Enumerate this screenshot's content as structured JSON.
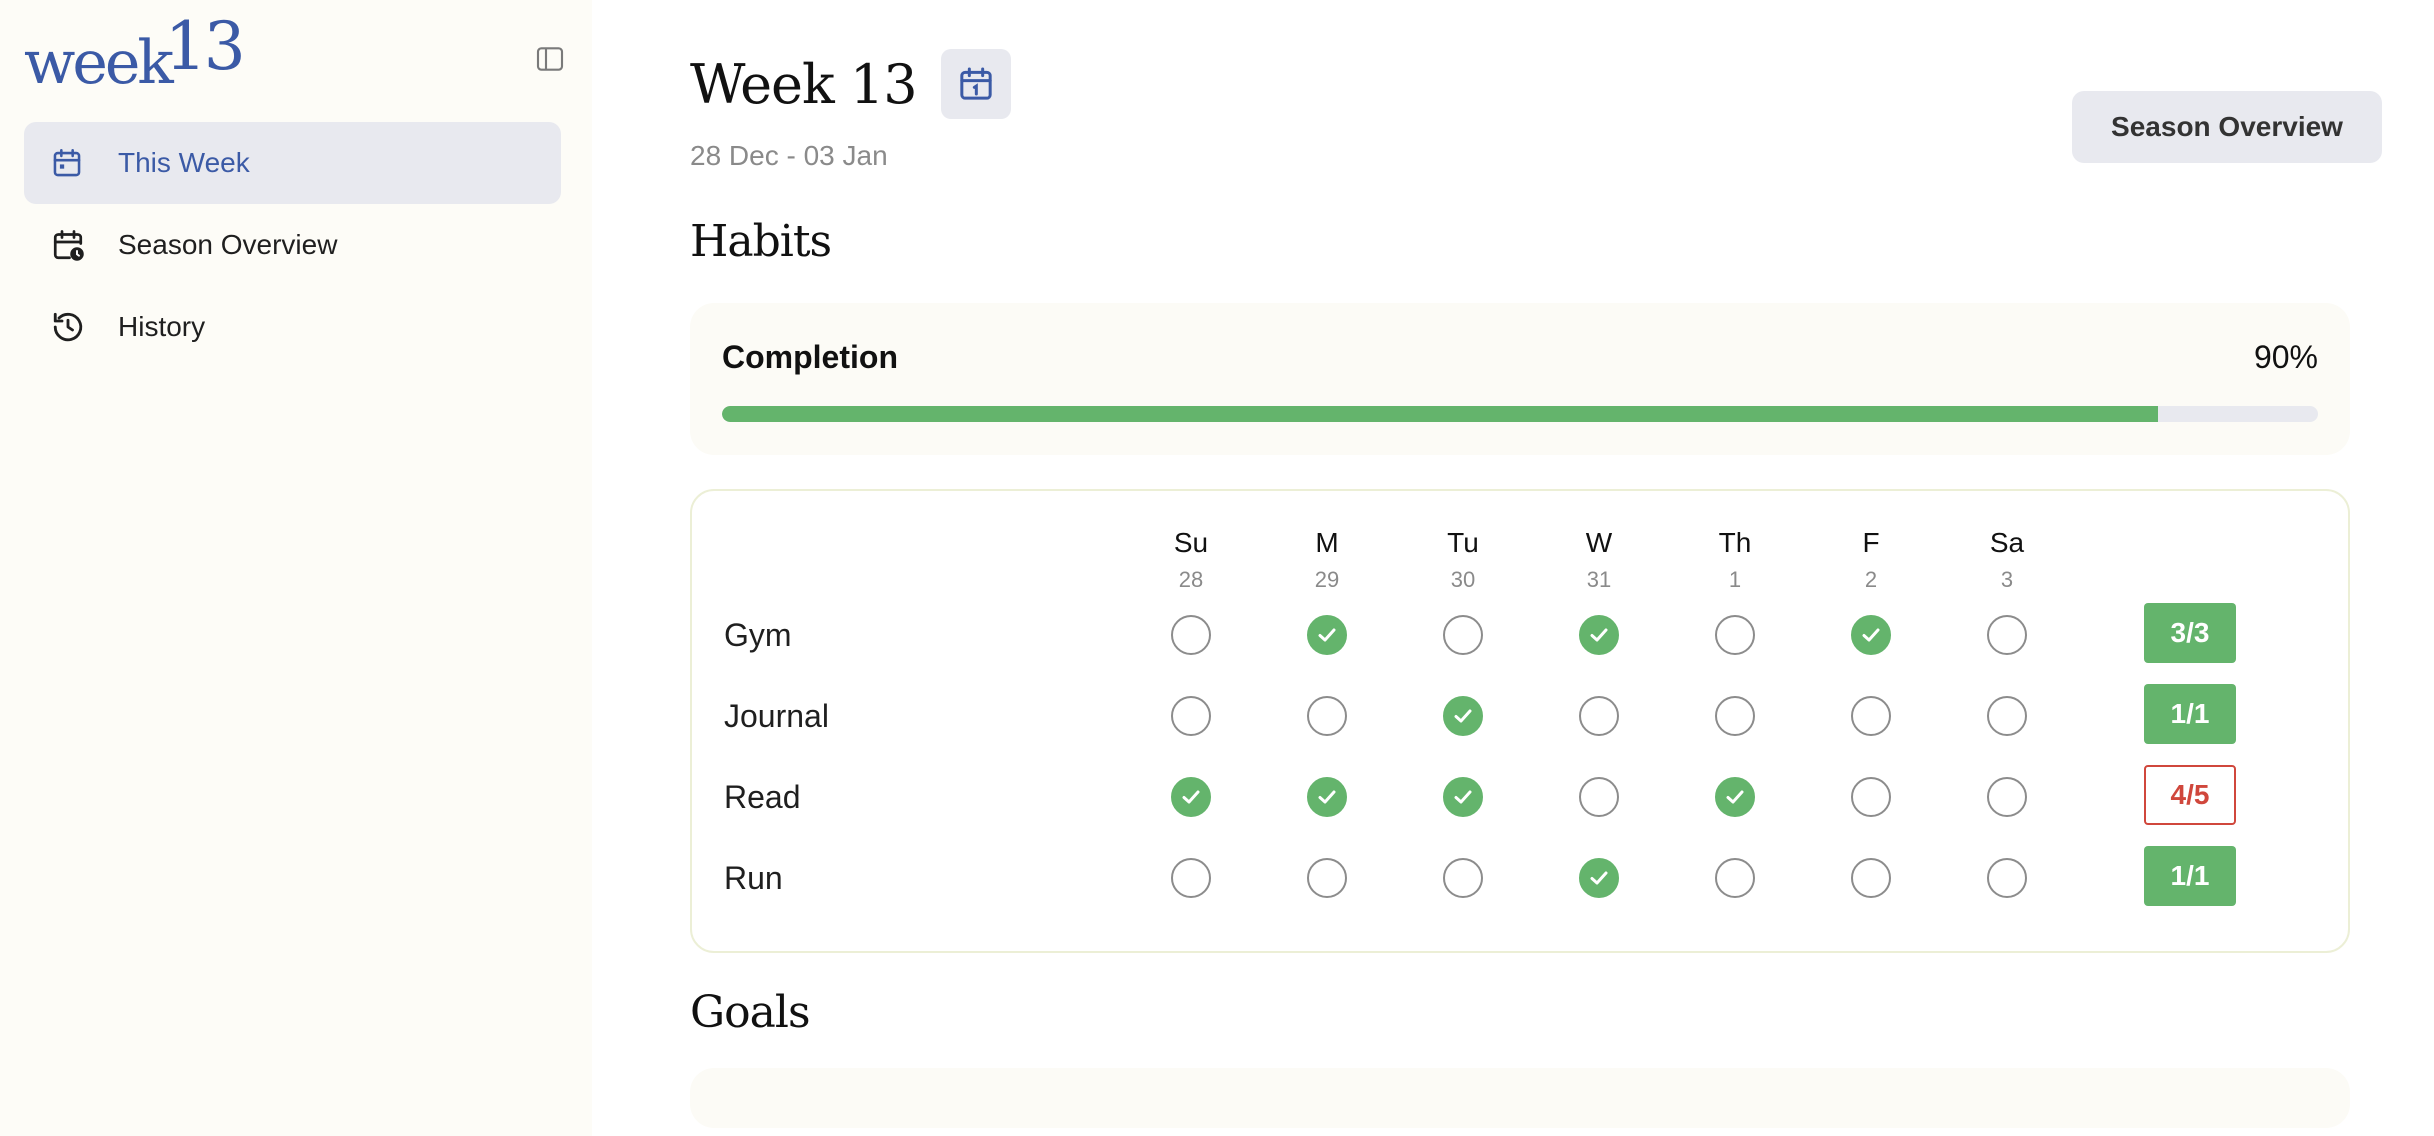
{
  "sidebar": {
    "logo_word": "week",
    "logo_num": "13",
    "nav": [
      {
        "label": "This Week",
        "icon": "calendar-icon",
        "active": true
      },
      {
        "label": "Season Overview",
        "icon": "calendar-clock-icon",
        "active": false
      },
      {
        "label": "History",
        "icon": "history-icon",
        "active": false
      }
    ]
  },
  "header": {
    "title": "Week 13",
    "date_range": "28 Dec - 03 Jan",
    "season_button": "Season Overview"
  },
  "habits": {
    "title": "Habits",
    "completion_label": "Completion",
    "completion_value": "90%",
    "completion_fraction": 0.9,
    "days": [
      {
        "name": "Su",
        "num": "28"
      },
      {
        "name": "M",
        "num": "29"
      },
      {
        "name": "Tu",
        "num": "30"
      },
      {
        "name": "W",
        "num": "31"
      },
      {
        "name": "Th",
        "num": "1"
      },
      {
        "name": "F",
        "num": "2"
      },
      {
        "name": "Sa",
        "num": "3"
      }
    ],
    "rows": [
      {
        "name": "Gym",
        "checks": [
          false,
          true,
          false,
          true,
          false,
          true,
          false
        ],
        "score": "3/3",
        "met": true
      },
      {
        "name": "Journal",
        "checks": [
          false,
          false,
          true,
          false,
          false,
          false,
          false
        ],
        "score": "1/1",
        "met": true
      },
      {
        "name": "Read",
        "checks": [
          true,
          true,
          true,
          false,
          true,
          false,
          false
        ],
        "score": "4/5",
        "met": false
      },
      {
        "name": "Run",
        "checks": [
          false,
          false,
          false,
          true,
          false,
          false,
          false
        ],
        "score": "1/1",
        "met": true
      }
    ]
  },
  "goals": {
    "title": "Goals"
  },
  "colors": {
    "accent": "#3b5aa6",
    "success": "#64b46c",
    "danger": "#d0473c"
  }
}
